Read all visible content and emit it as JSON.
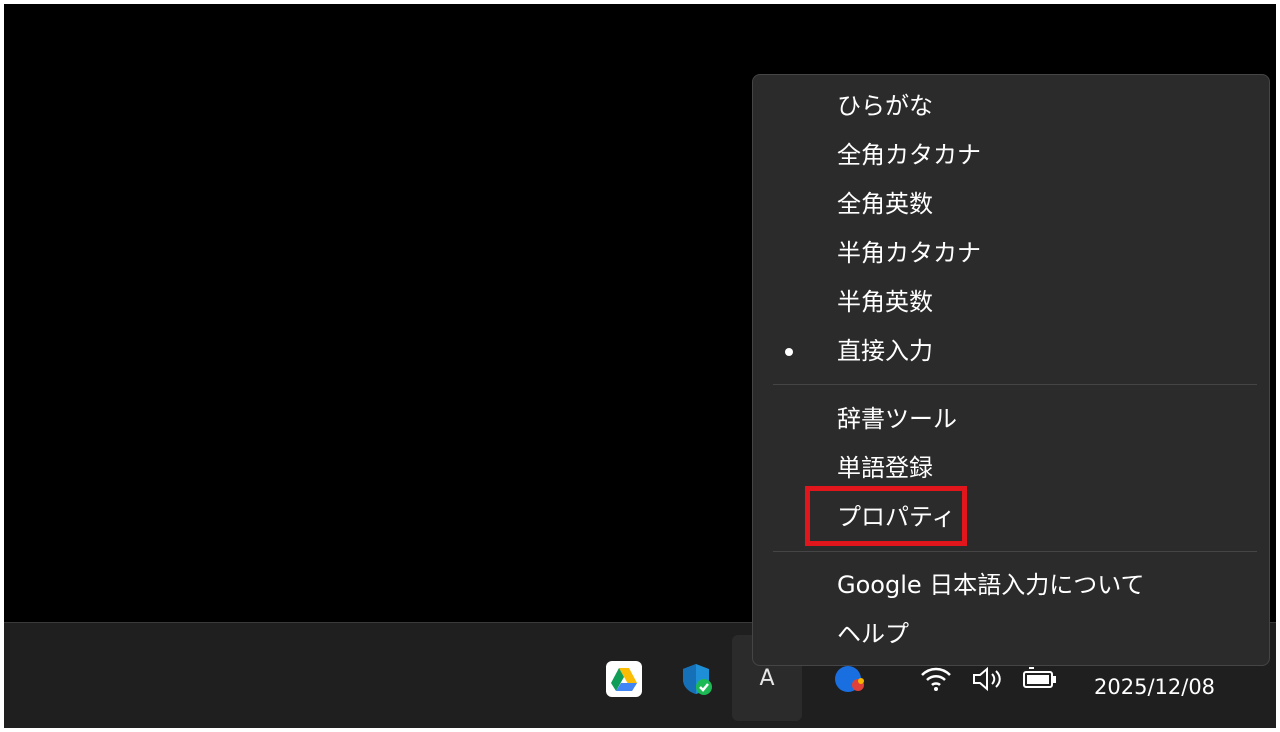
{
  "menu": {
    "input_modes": [
      {
        "label": "ひらがな",
        "selected": false
      },
      {
        "label": "全角カタカナ",
        "selected": false
      },
      {
        "label": "全角英数",
        "selected": false
      },
      {
        "label": "半角カタカナ",
        "selected": false
      },
      {
        "label": "半角英数",
        "selected": false
      },
      {
        "label": "直接入力",
        "selected": true
      }
    ],
    "tools": [
      {
        "label": "辞書ツール"
      },
      {
        "label": "単語登録"
      },
      {
        "label": "プロパティ"
      }
    ],
    "about": [
      {
        "label": "Google 日本語入力について"
      },
      {
        "label": "ヘルプ"
      }
    ]
  },
  "taskbar": {
    "ime_indicator": "A",
    "clock_date": "2025/12/08",
    "tray_icons": [
      "google-drive-icon",
      "windows-security-icon",
      "copilot-icon",
      "wifi-icon",
      "volume-icon",
      "battery-icon"
    ]
  },
  "colors": {
    "menu_bg": "#2b2b2b",
    "highlight": "#e0161c",
    "taskbar_bg": "#1f1f1f"
  }
}
